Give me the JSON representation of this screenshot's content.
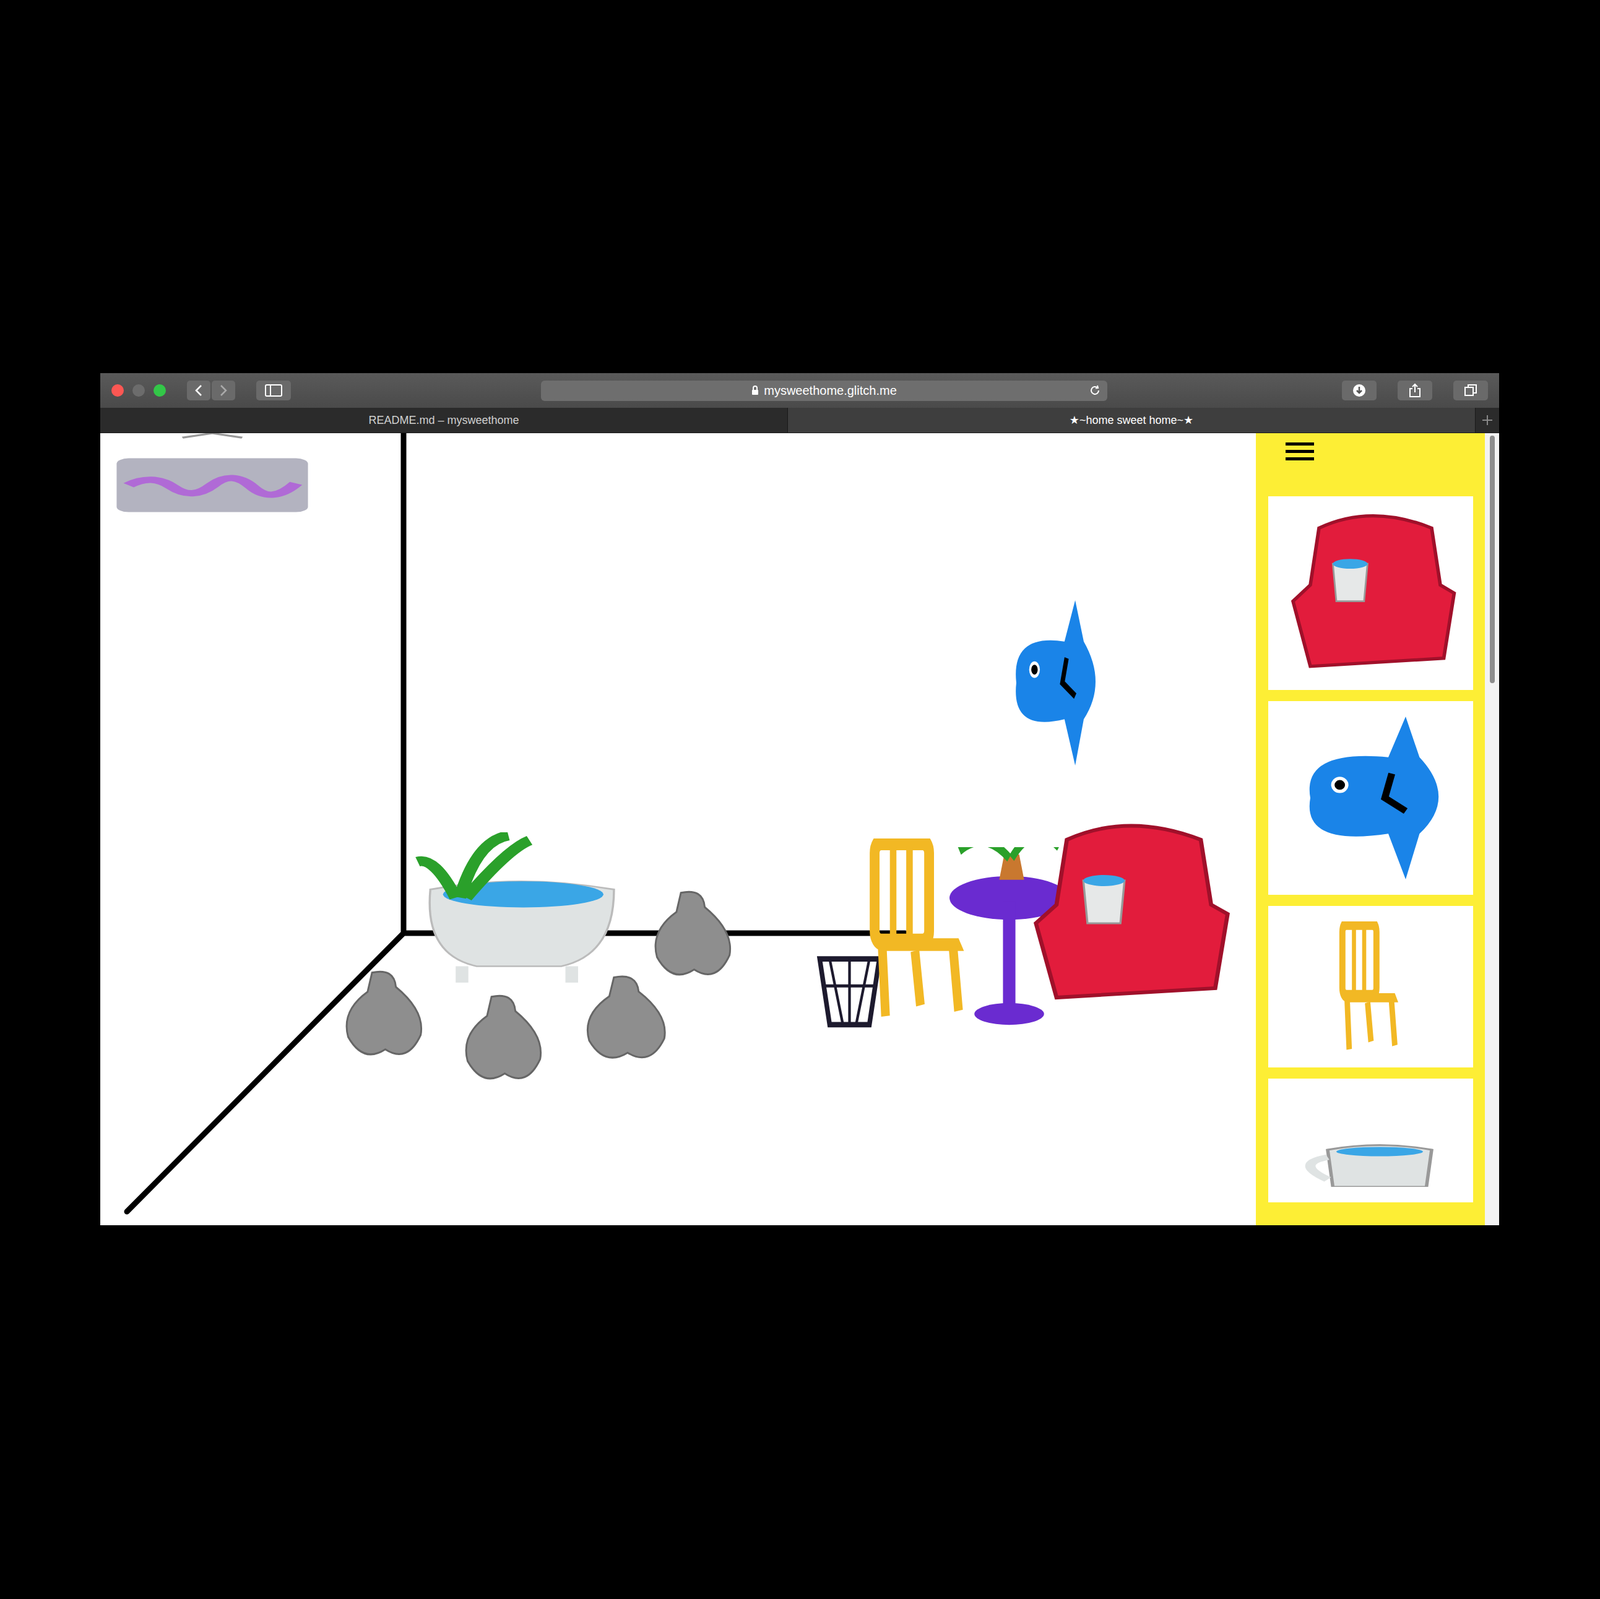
{
  "browser": {
    "address": "mysweethome.glitch.me",
    "tabs": [
      {
        "label": "README.md – mysweethome",
        "selected": false
      },
      {
        "label": "★~home sweet home~★",
        "selected": true
      }
    ]
  },
  "scene": {
    "objects": [
      {
        "kind": "sign",
        "color": "#b3b3c0"
      },
      {
        "kind": "clock",
        "color": "#1a84e8"
      },
      {
        "kind": "tub",
        "color": "#dfe3e3"
      },
      {
        "kind": "rock",
        "color": "#8e8e8e"
      },
      {
        "kind": "rock",
        "color": "#8e8e8e"
      },
      {
        "kind": "rock",
        "color": "#8e8e8e"
      },
      {
        "kind": "rock",
        "color": "#8e8e8e"
      },
      {
        "kind": "basket",
        "color": "#1d1a2e"
      },
      {
        "kind": "chair",
        "color": "#f2b824"
      },
      {
        "kind": "table",
        "color": "#6a2bd0"
      },
      {
        "kind": "armchair",
        "color": "#e21c3c"
      }
    ]
  },
  "sidebar": {
    "items": [
      {
        "kind": "armchair",
        "color": "#e21c3c"
      },
      {
        "kind": "clock",
        "color": "#1a84e8"
      },
      {
        "kind": "chair",
        "color": "#f2b824"
      },
      {
        "kind": "mug",
        "color": "#dfe3e3"
      }
    ]
  }
}
